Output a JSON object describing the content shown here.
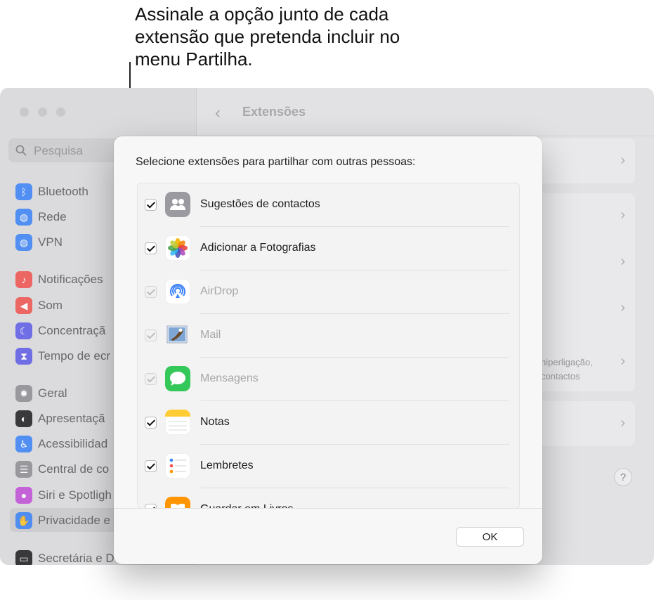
{
  "callout": {
    "text": "Assinale a opção junto de cada extensão que pretenda incluir no menu Partilha."
  },
  "sidebar": {
    "search_placeholder": "Pesquisa",
    "items": [
      {
        "label": "Bluetooth",
        "icon": "bluetooth-icon",
        "color": "#3a82f7"
      },
      {
        "label": "Rede",
        "icon": "globe-icon",
        "color": "#3a82f7"
      },
      {
        "label": "VPN",
        "icon": "vpn-globe-icon",
        "color": "#3a82f7"
      },
      {
        "label": "Notificações",
        "icon": "bell-icon",
        "color": "#f0524f"
      },
      {
        "label": "Som",
        "icon": "speaker-icon",
        "color": "#f0524f"
      },
      {
        "label": "Concentraçã",
        "icon": "moon-icon",
        "color": "#5e5ce6"
      },
      {
        "label": "Tempo de ecr",
        "icon": "hourglass-icon",
        "color": "#5e5ce6"
      },
      {
        "label": "Geral",
        "icon": "gear-icon",
        "color": "#8e8e93"
      },
      {
        "label": "Apresentaçã",
        "icon": "appearance-icon",
        "color": "#1d1d1f"
      },
      {
        "label": "Acessibilidad",
        "icon": "accessibility-icon",
        "color": "#3a82f7"
      },
      {
        "label": "Central de co",
        "icon": "control-center-icon",
        "color": "#8e8e93"
      },
      {
        "label": "Siri e Spotligh",
        "icon": "siri-icon",
        "color": "#c04fd8"
      },
      {
        "label": "Privacidade e",
        "icon": "hand-icon",
        "color": "#3a82f7"
      },
      {
        "label": "Secretária e D",
        "icon": "dock-icon",
        "color": "#1d1d1f"
      }
    ]
  },
  "topbar": {
    "back_glyph": "‹",
    "title": "Extensões"
  },
  "background_text": {
    "line1": "hiperligação,",
    "line2": "contactos"
  },
  "help_label": "?",
  "dialog": {
    "prompt": "Selecione extensões para partilhar com outras pessoas:",
    "items": [
      {
        "label": "Sugestões de contactos",
        "checked": true,
        "enabled": true,
        "icon": "contacts-icon"
      },
      {
        "label": "Adicionar a Fotografias",
        "checked": true,
        "enabled": true,
        "icon": "photos-icon"
      },
      {
        "label": "AirDrop",
        "checked": true,
        "enabled": false,
        "icon": "airdrop-icon"
      },
      {
        "label": "Mail",
        "checked": true,
        "enabled": false,
        "icon": "mail-icon"
      },
      {
        "label": "Mensagens",
        "checked": true,
        "enabled": false,
        "icon": "messages-icon"
      },
      {
        "label": "Notas",
        "checked": true,
        "enabled": true,
        "icon": "notes-icon"
      },
      {
        "label": "Lembretes",
        "checked": true,
        "enabled": true,
        "icon": "reminders-icon"
      },
      {
        "label": "Guardar em Livros",
        "checked": true,
        "enabled": true,
        "icon": "books-icon"
      }
    ],
    "ok_label": "OK"
  }
}
